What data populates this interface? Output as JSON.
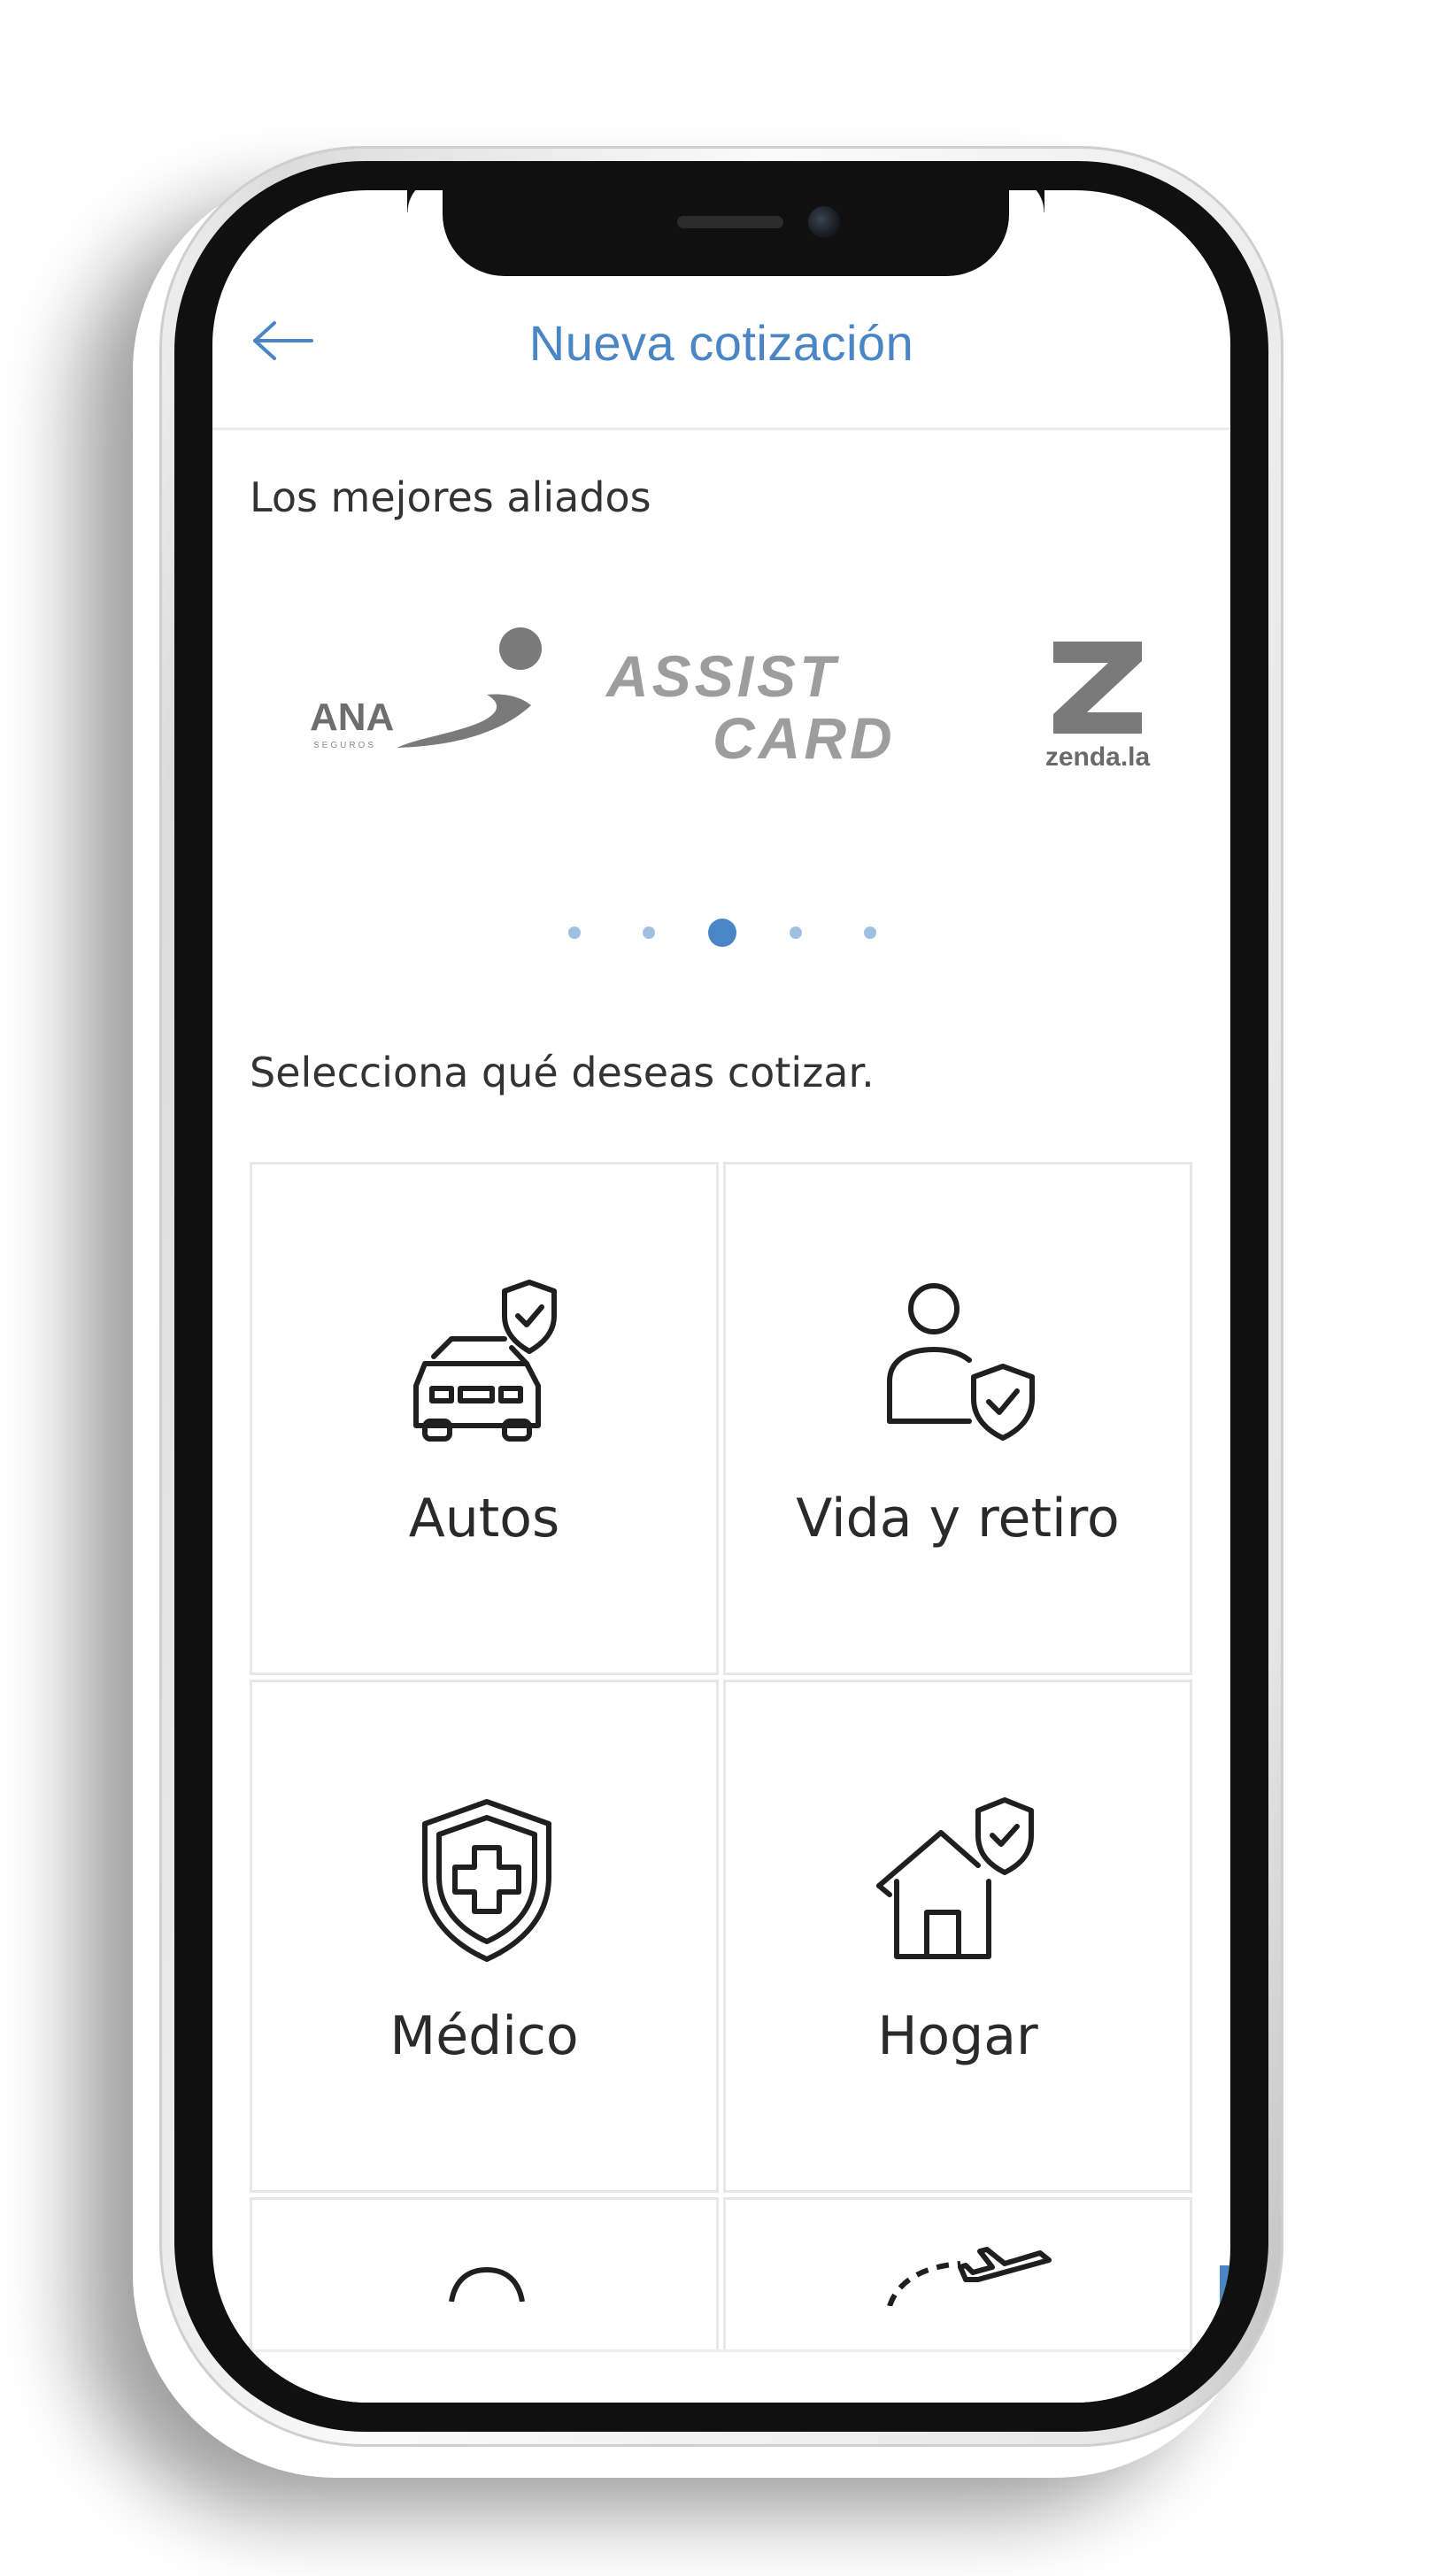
{
  "header": {
    "title": "Nueva cotización",
    "back_icon": "arrow-left-icon"
  },
  "partners": {
    "label": "Los mejores aliados",
    "logos": [
      {
        "name": "ANA",
        "sub": "SEGUROS"
      },
      {
        "name": "ASSIST CARD"
      },
      {
        "name": "zenda.la"
      }
    ],
    "pagination": {
      "total": 5,
      "active": 3
    }
  },
  "quote": {
    "label": "Selecciona qué deseas cotizar.",
    "options": [
      {
        "label": "Autos",
        "icon": "car-shield-icon"
      },
      {
        "label": "Vida y retiro",
        "icon": "person-shield-icon"
      },
      {
        "label": "Médico",
        "icon": "medical-shield-icon"
      },
      {
        "label": "Hogar",
        "icon": "house-shield-icon"
      }
    ]
  },
  "colors": {
    "accent": "#4a86c5",
    "text": "#2a2a2a",
    "border": "#e7e7e7"
  }
}
